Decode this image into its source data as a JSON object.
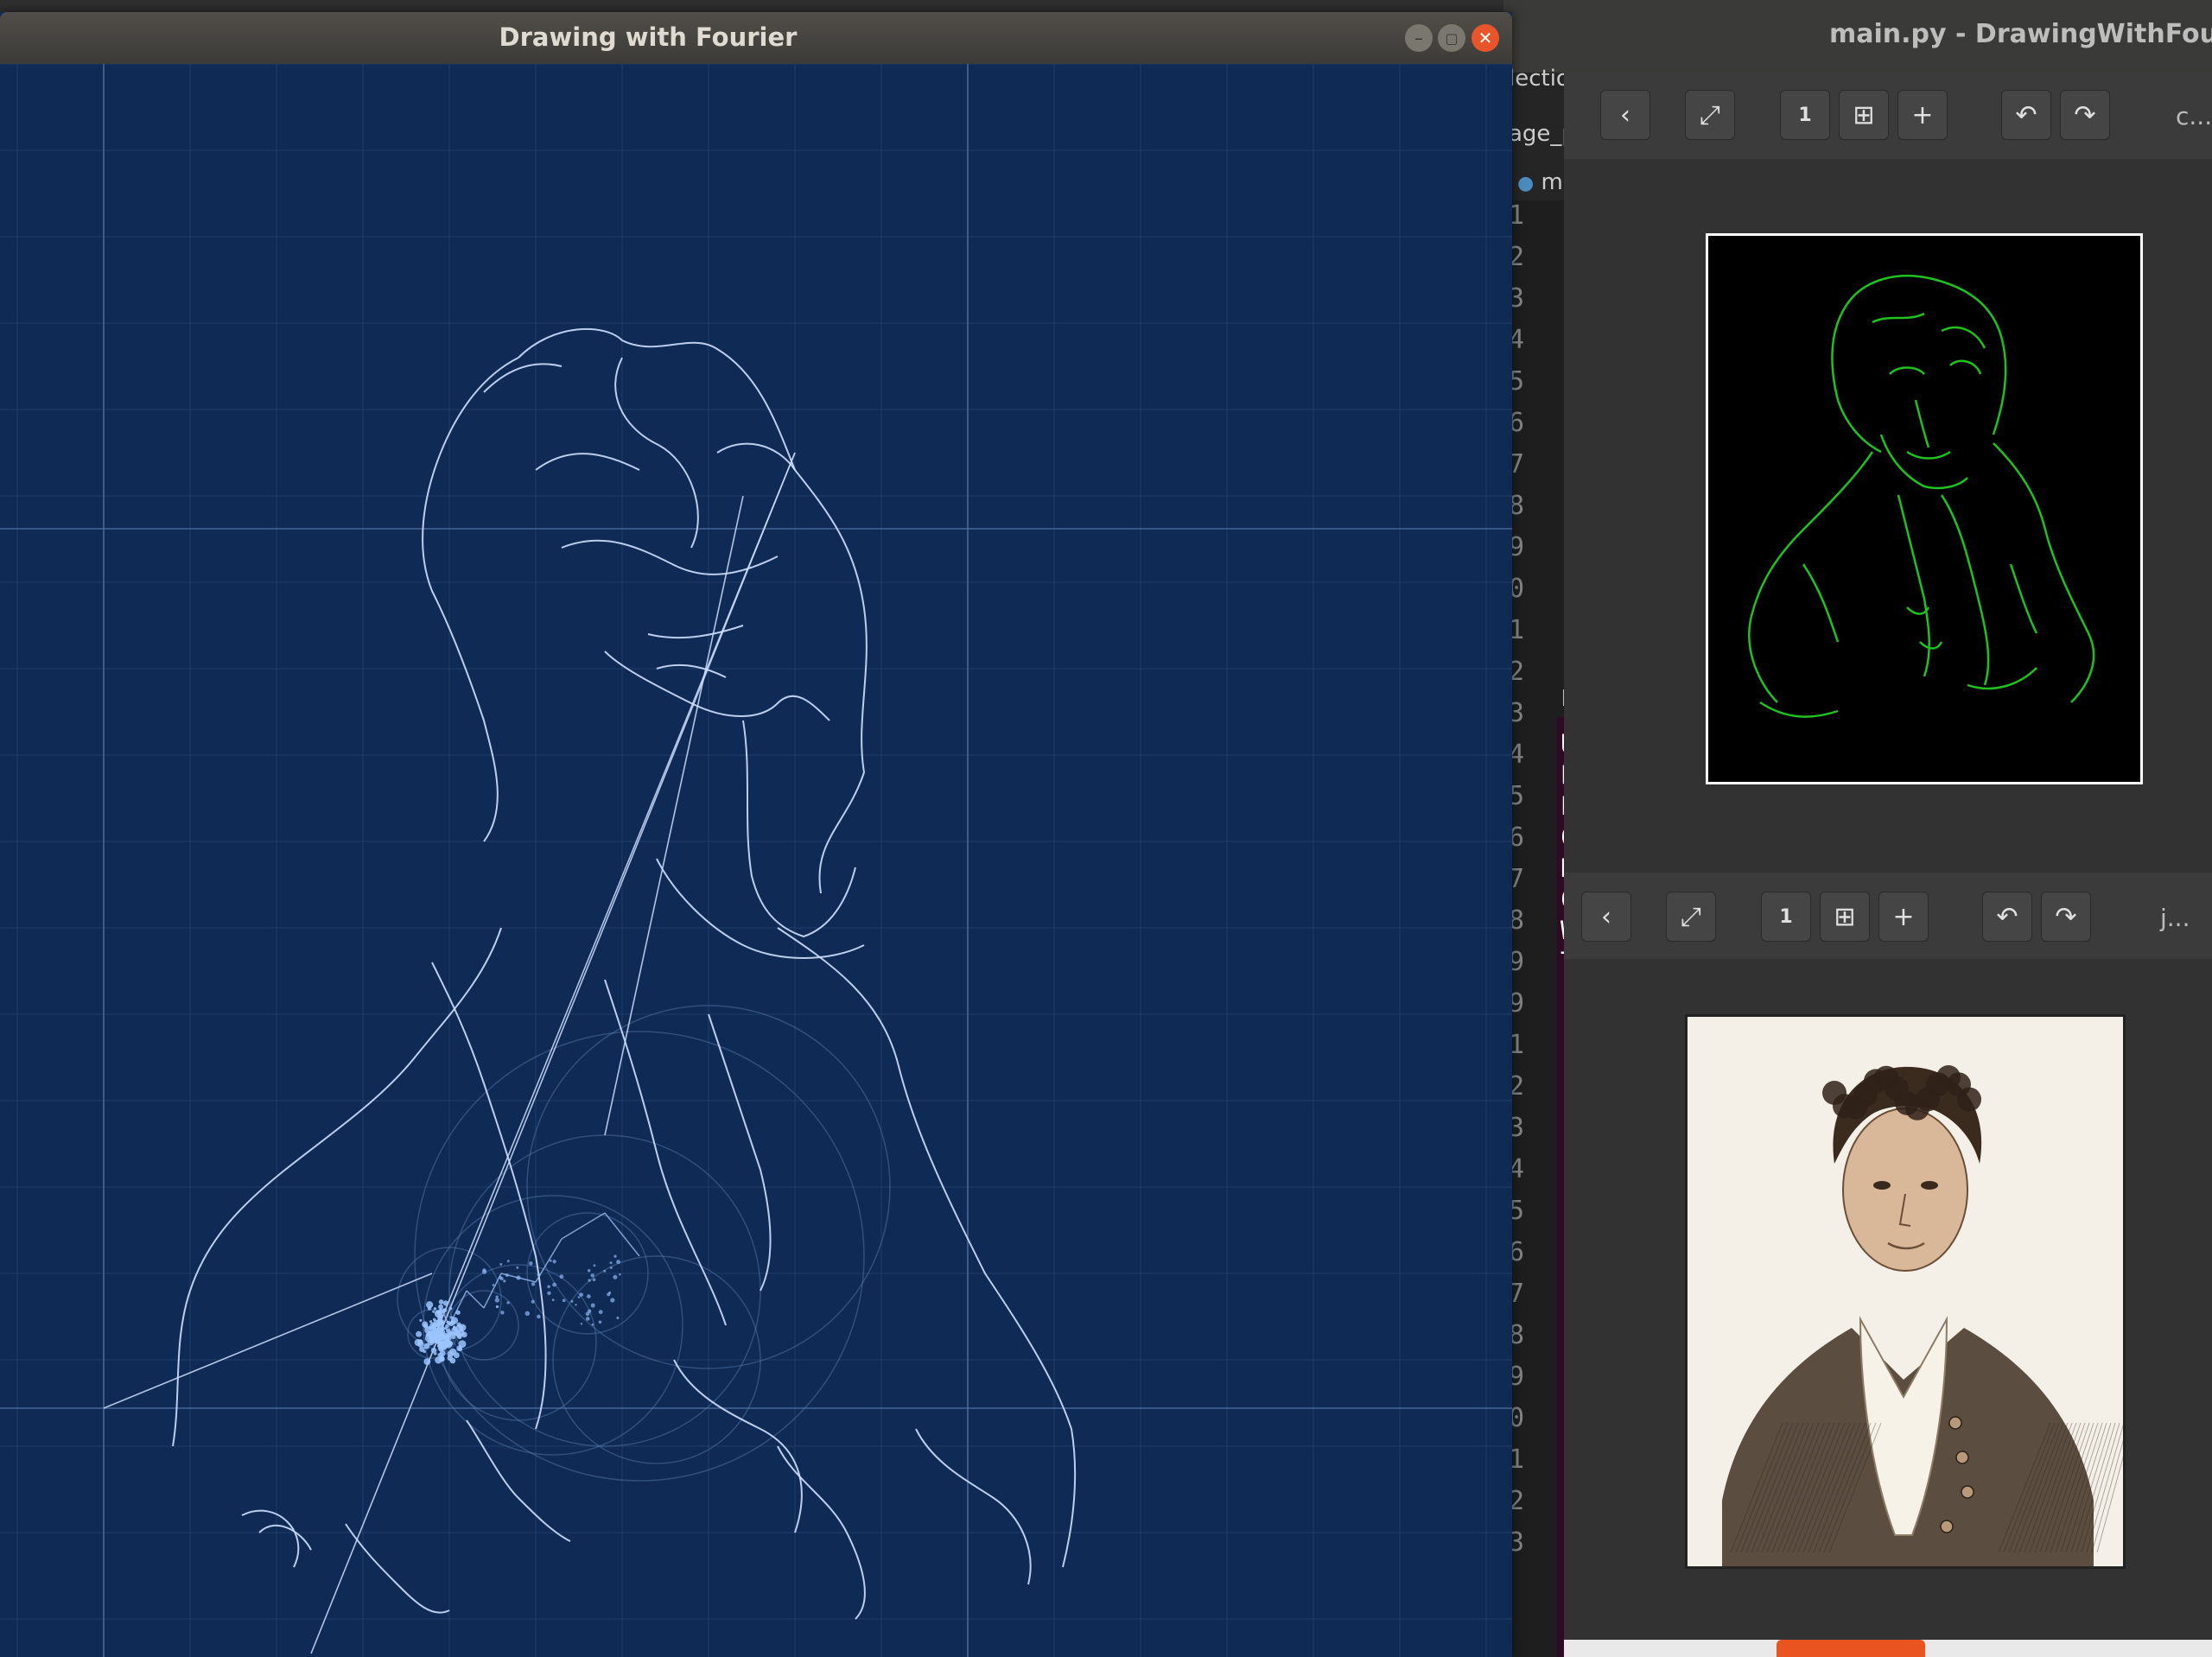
{
  "fourier_window": {
    "title": "Drawing with Fourier",
    "buttons": [
      "minimize",
      "maximize",
      "close"
    ]
  },
  "editor_window": {
    "title": "main.py - DrawingWithFourier -",
    "tabs": [
      "lection",
      "age_pro",
      "mai"
    ],
    "line_numbers": [
      "1",
      "2",
      "3",
      "4",
      "5",
      "6",
      "7",
      "8",
      "9",
      "0",
      "1",
      "2",
      "3",
      "4",
      "5",
      "6",
      "7",
      "8",
      "9",
      "9",
      "1",
      "2",
      "3",
      "4",
      "5",
      "6",
      "7",
      "8",
      "9",
      "0",
      "1",
      "2",
      "3"
    ],
    "code_chars": [
      "i",
      "i",
      "f",
      "",
      "f",
      "",
      "f",
      "f",
      "f"
    ],
    "panel_label": "F",
    "terminal_lines": [
      "Us",
      "Pa",
      "Er",
      "Co",
      "De",
      "C",
      "W",
      "T"
    ]
  },
  "viewer_top": {
    "label": "c...",
    "image": "edge-detected-portrait"
  },
  "viewer_bottom": {
    "label": "j...",
    "image": "portrait-engraving"
  },
  "colors": {
    "canvas_bg": "#0f2b55",
    "grid": "#2a4a78",
    "stroke": "#cfe0ff",
    "edge_green": "#1fc21f",
    "term_bg": "#300a24"
  }
}
